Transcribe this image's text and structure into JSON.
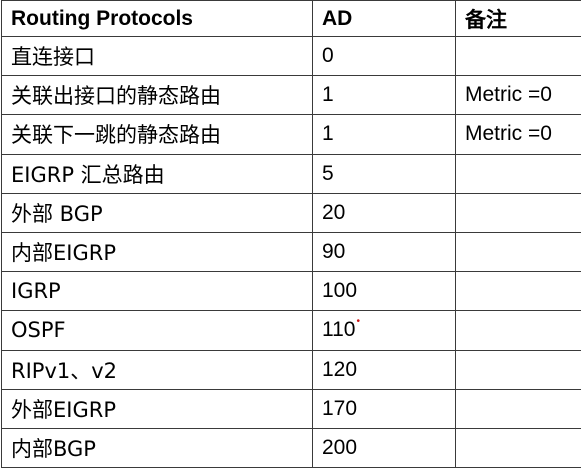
{
  "table": {
    "headers": [
      "Routing Protocols",
      "AD",
      "备注"
    ],
    "rows": [
      {
        "protocol": "直连接口",
        "ad": "0",
        "note": ""
      },
      {
        "protocol": "关联出接口的静态路由",
        "ad": "1",
        "note": "Metric =0"
      },
      {
        "protocol": "关联下一跳的静态路由",
        "ad": "1",
        "note": "Metric =0"
      },
      {
        "protocol": "EIGRP 汇总路由",
        "ad": "5",
        "note": ""
      },
      {
        "protocol": "外部 BGP",
        "ad": "20",
        "note": ""
      },
      {
        "protocol": "内部EIGRP",
        "ad": "90",
        "note": ""
      },
      {
        "protocol": "IGRP",
        "ad": "100",
        "note": ""
      },
      {
        "protocol": "OSPF",
        "ad": "110",
        "note": ""
      },
      {
        "protocol": "RIPv1、v2",
        "ad": "120",
        "note": ""
      },
      {
        "protocol": "外部EIGRP",
        "ad": "170",
        "note": ""
      },
      {
        "protocol": "内部BGP",
        "ad": "200",
        "note": ""
      }
    ]
  },
  "colors": {
    "border": "#3a3a3a",
    "text": "#000000",
    "mark": "#cc1111"
  }
}
